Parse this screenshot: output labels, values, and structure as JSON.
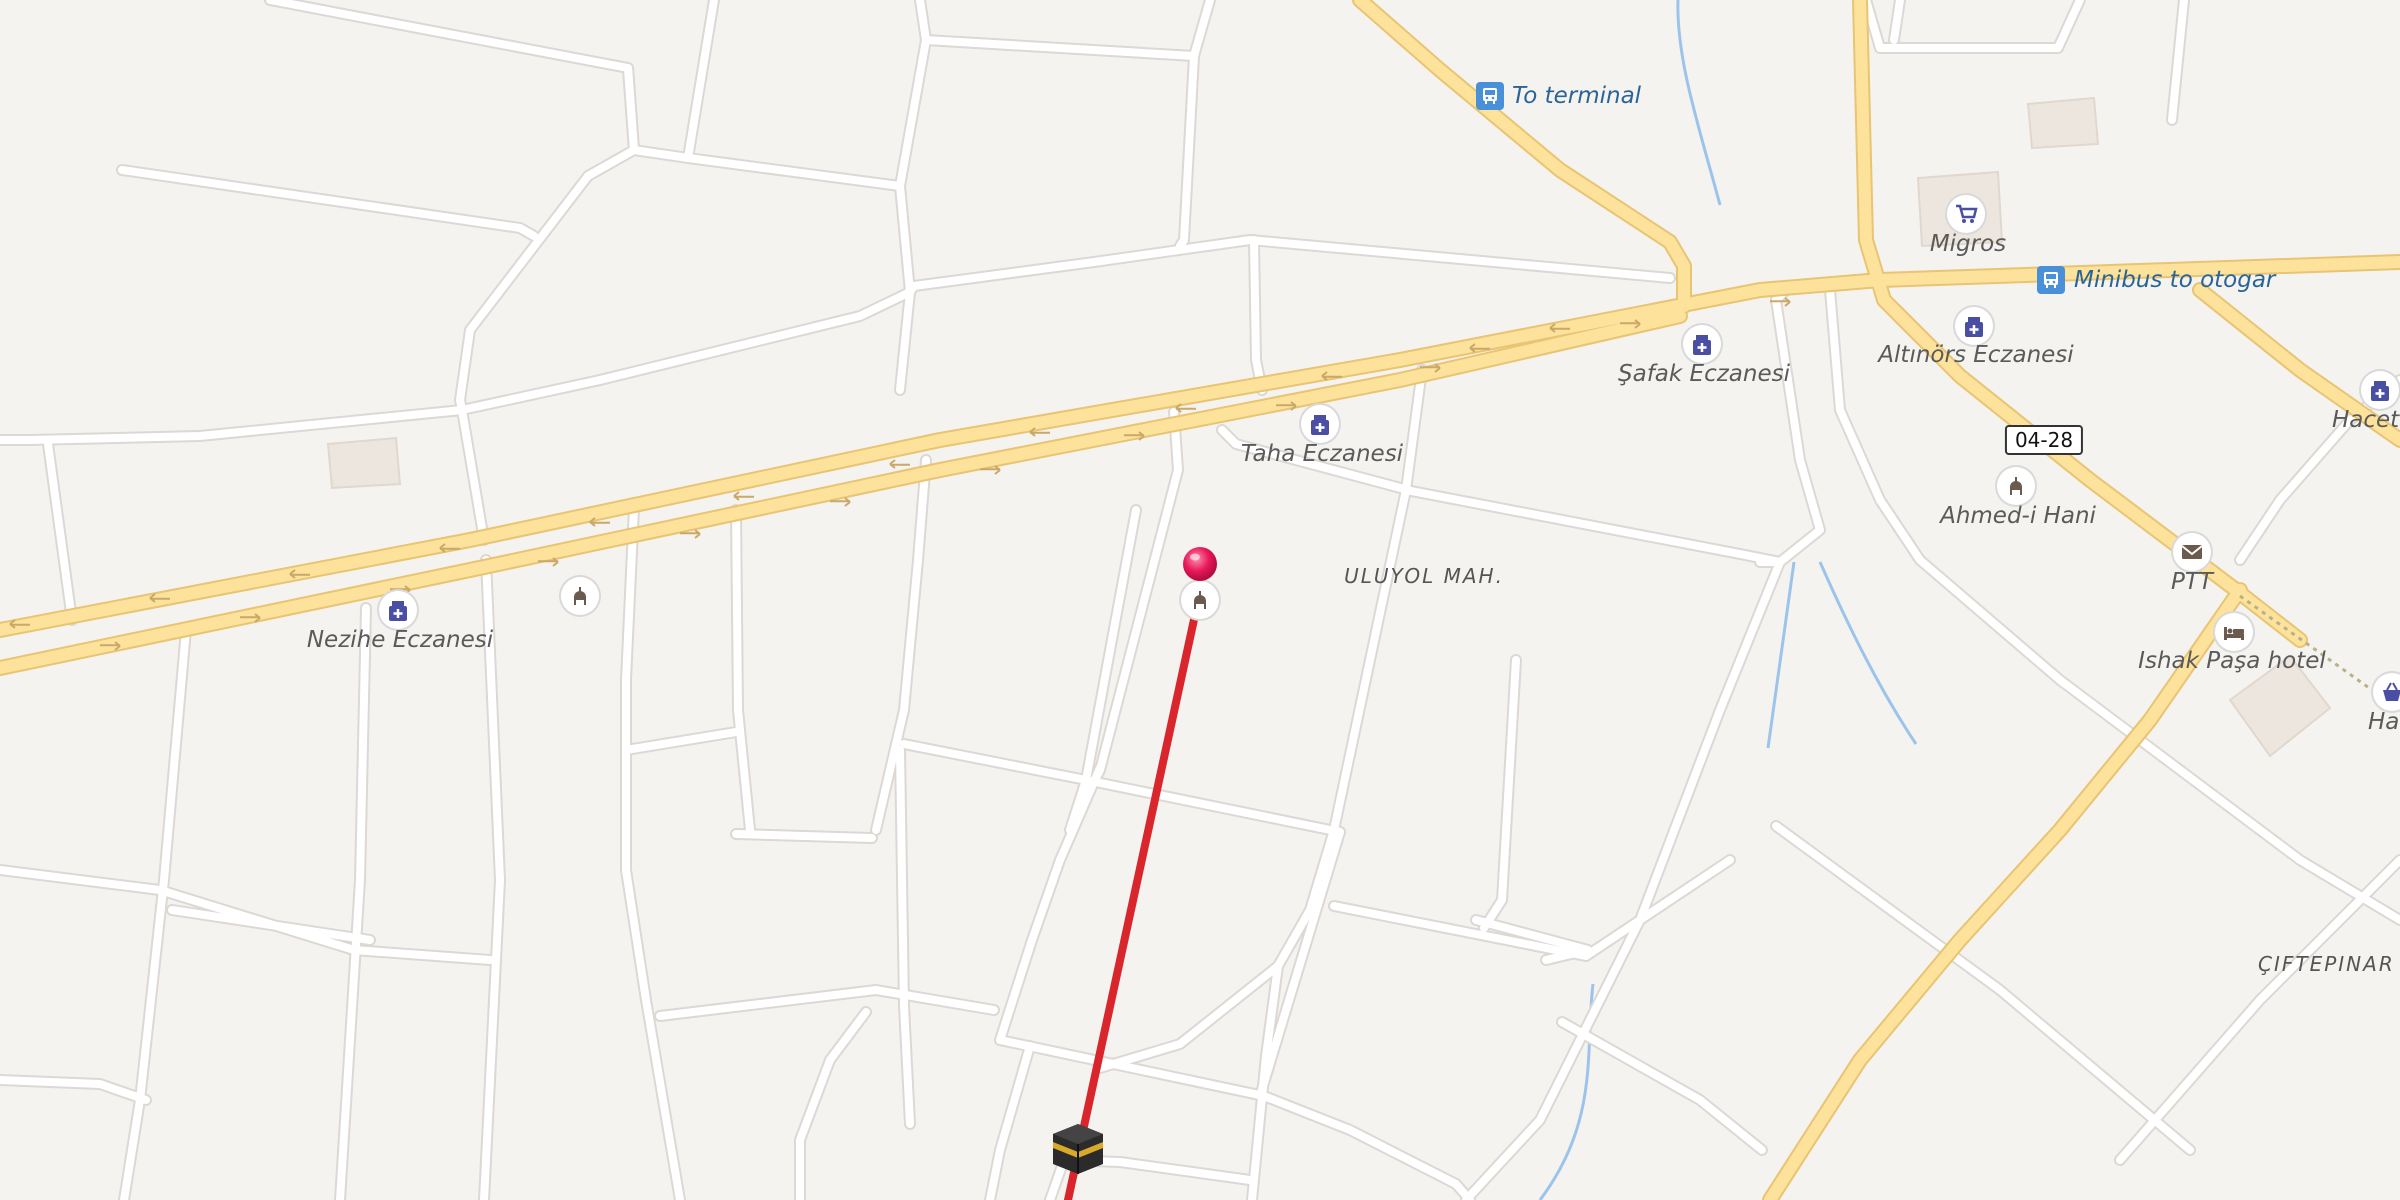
{
  "map": {
    "colors": {
      "background": "#f5f3f0",
      "road_minor": "#ffffff",
      "road_minor_casing": "#dcd8d3",
      "road_major": "#fde29c",
      "road_major_casing": "#e8c473",
      "water": "#9cc4eb",
      "route": "#d9262c",
      "building": "#ece6de",
      "poi_icon": "#4b4fa3",
      "transit": "#4a90d9",
      "label_text": "#5a5a5a",
      "transit_text": "#2a6496"
    },
    "labels": {
      "to_terminal": "To terminal",
      "minibus": "Minibus to otogar",
      "migros": "Migros",
      "safak": "Şafak Eczanesi",
      "altinors": "Altınörs Eczanesi",
      "hacette": "Hacette",
      "taha": "Taha Eczanesi",
      "nezihe": "Nezihe Eczanesi",
      "ahmedi_hani": "Ahmed-i Hani",
      "ptt": "PTT",
      "ishak_pasa": "Ishak Paşa hotel",
      "halk": "Halk",
      "uluyol": "ULUYOL MAH.",
      "ciftepinar": "ÇIFTEPINAR M"
    },
    "road_shield": "04-28",
    "pois": [
      {
        "id": "pharmacy-nezihe",
        "icon": "pharmacy-icon"
      },
      {
        "id": "pharmacy-taha",
        "icon": "pharmacy-icon"
      },
      {
        "id": "pharmacy-safak",
        "icon": "pharmacy-icon"
      },
      {
        "id": "pharmacy-altinors",
        "icon": "pharmacy-icon"
      },
      {
        "id": "pharmacy-hacette",
        "icon": "pharmacy-icon"
      },
      {
        "id": "mosque-west",
        "icon": "mosque-icon"
      },
      {
        "id": "mosque-center",
        "icon": "mosque-icon"
      },
      {
        "id": "landmark-ahmedi-hani",
        "icon": "mosque-icon"
      },
      {
        "id": "shop-migros",
        "icon": "shopping-cart-icon"
      },
      {
        "id": "post-ptt",
        "icon": "envelope-icon"
      },
      {
        "id": "hotel-ishak-pasa",
        "icon": "bed-icon"
      },
      {
        "id": "shop-halk",
        "icon": "shopping-basket-icon"
      }
    ]
  }
}
